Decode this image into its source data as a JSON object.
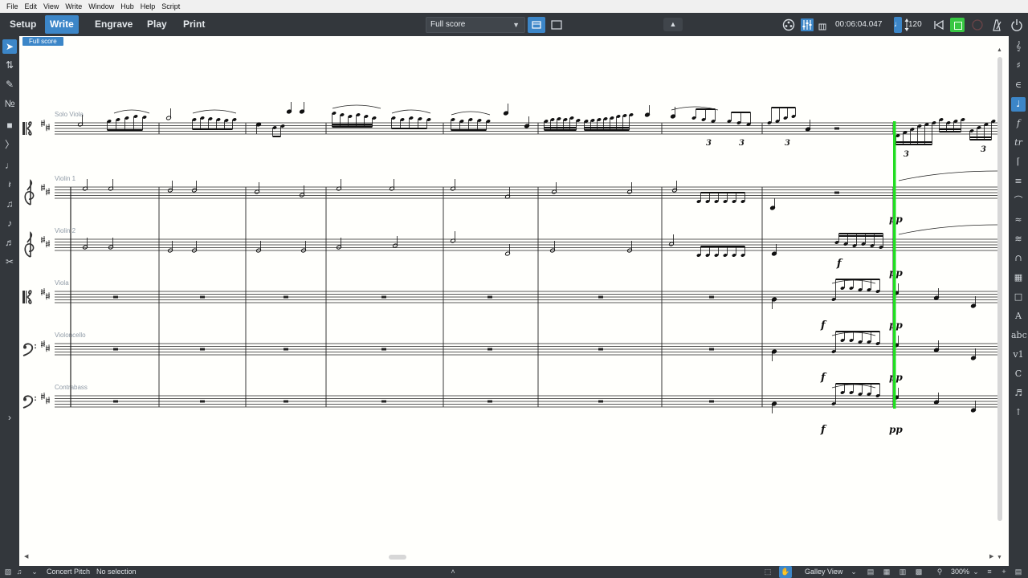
{
  "menu": [
    "File",
    "Edit",
    "View",
    "Write",
    "Window",
    "Hub",
    "Help",
    "Script"
  ],
  "modes": [
    {
      "label": "Setup",
      "active": false
    },
    {
      "label": "Write",
      "active": true
    },
    {
      "label": "Engrave",
      "active": false
    },
    {
      "label": "Play",
      "active": false
    },
    {
      "label": "Print",
      "active": false
    }
  ],
  "layout_select": {
    "value": "Full score"
  },
  "transport": {
    "time": "00:06:04.047",
    "tempo_note_icon": "quarter-note-icon",
    "tempo": "120"
  },
  "score": {
    "layout_tab": "Full score",
    "instruments": [
      {
        "name": "Solo Viola",
        "clef": "alto"
      },
      {
        "name": "Violin 1",
        "clef": "treble"
      },
      {
        "name": "Violin 2",
        "clef": "treble"
      },
      {
        "name": "Viola",
        "clef": "alto"
      },
      {
        "name": "Violoncello",
        "clef": "bass"
      },
      {
        "name": "Contrabass",
        "clef": "bass"
      }
    ],
    "dynamics": {
      "forte": "f",
      "pianissimo": "pp"
    },
    "tuplet_number": "3",
    "playhead_color": "#22dd22",
    "accent_color": "#3c86c8"
  },
  "status": {
    "concert_pitch": "Concert Pitch",
    "selection": "No selection",
    "view_mode": "Galley View",
    "zoom": "300%"
  }
}
